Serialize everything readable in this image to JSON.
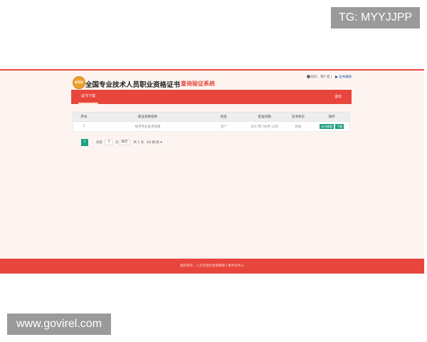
{
  "watermarks": {
    "top": "TG: MYYJJPP",
    "bottom": "www.govirel.com"
  },
  "header": {
    "emblem_text": "RTZK",
    "title": "全国专业技术人员职业资格证书",
    "subtitle": "查询验证系统",
    "user_greeting": "您好，用户名",
    "divider": "|",
    "notice_link": "证书通知"
  },
  "nav": {
    "active_tab": "证书下载",
    "right_link": "退出"
  },
  "table": {
    "headers": [
      "序号",
      "职业资格名称",
      "姓名",
      "批准日期",
      "证书状态",
      "操作"
    ],
    "rows": [
      {
        "index": "1",
        "name": "经济专业技术资格",
        "person": "刘**",
        "date": "2017年 06月 12日",
        "status": "有效",
        "actions": [
          "证书查看",
          "下载"
        ]
      }
    ]
  },
  "pager": {
    "prev": "‹",
    "current": "1",
    "next": "›",
    "goto_label": "到第",
    "goto_value": "1",
    "page_unit": "页",
    "confirm": "确定",
    "total": "共 1 条",
    "page_size": "10 条/页 ▾"
  },
  "footer": {
    "text": "版权所有：人力资源社会保障部人事考试中心"
  },
  "colors": {
    "brand_red": "#e8453c",
    "action_green": "#20a080"
  }
}
